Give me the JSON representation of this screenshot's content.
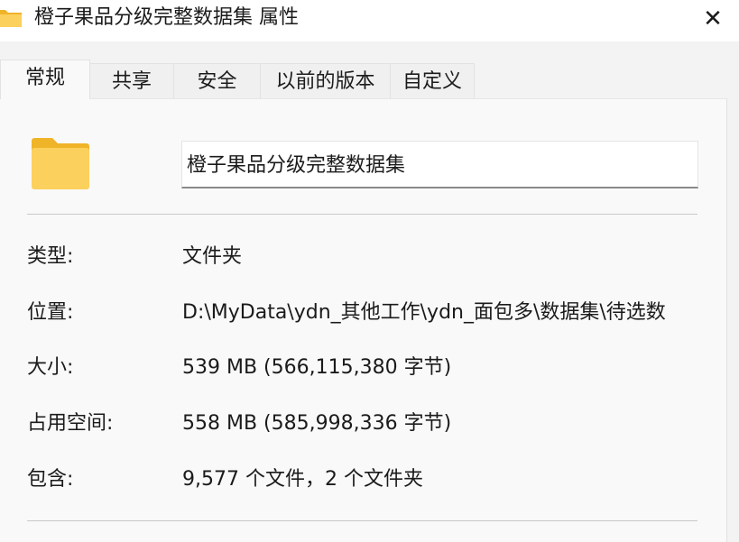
{
  "window": {
    "title": "橙子果品分级完整数据集 属性",
    "close_symbol": "✕"
  },
  "tabs": [
    {
      "label": "常规",
      "active": true
    },
    {
      "label": "共享",
      "active": false
    },
    {
      "label": "安全",
      "active": false
    },
    {
      "label": "以前的版本",
      "active": false
    },
    {
      "label": "自定义",
      "active": false
    }
  ],
  "general": {
    "folder_icon": "folder-icon",
    "name_value": "橙子果品分级完整数据集",
    "rows": [
      {
        "label": "类型:",
        "value": "文件夹"
      },
      {
        "label": "位置:",
        "value": "D:\\MyData\\ydn_其他工作\\ydn_面包多\\数据集\\待选数"
      },
      {
        "label": "大小:",
        "value": "539 MB (566,115,380 字节)"
      },
      {
        "label": "占用空间:",
        "value": "558 MB (585,998,336 字节)"
      },
      {
        "label": "包含:",
        "value": "9,577 个文件，2 个文件夹"
      }
    ]
  },
  "colors": {
    "folder_back": "#f0b429",
    "folder_front": "#fcd05c"
  }
}
